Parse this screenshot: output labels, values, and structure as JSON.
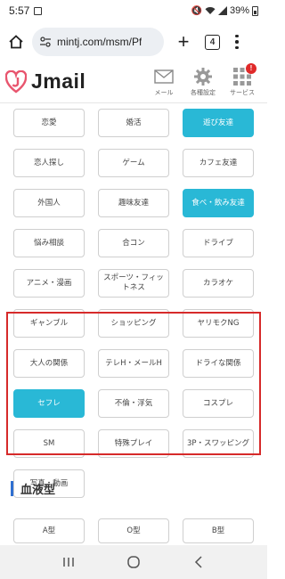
{
  "status": {
    "time": "5:57",
    "battery": "39%"
  },
  "browser": {
    "url": "mintj.com/msm/Pf",
    "tab_count": "4"
  },
  "site": {
    "logo_text": "Jmail",
    "icons": [
      {
        "label": "メール"
      },
      {
        "label": "各種設定"
      },
      {
        "label": "サービス",
        "badge": "!"
      }
    ]
  },
  "tags": [
    {
      "label": "恋愛",
      "selected": false
    },
    {
      "label": "婚活",
      "selected": false
    },
    {
      "label": "遊び友達",
      "selected": true
    },
    {
      "label": "恋人探し",
      "selected": false
    },
    {
      "label": "ゲーム",
      "selected": false
    },
    {
      "label": "カフェ友達",
      "selected": false
    },
    {
      "label": "外国人",
      "selected": false
    },
    {
      "label": "趣味友達",
      "selected": false
    },
    {
      "label": "食べ・飲み友達",
      "selected": true
    },
    {
      "label": "悩み相談",
      "selected": false
    },
    {
      "label": "合コン",
      "selected": false
    },
    {
      "label": "ドライブ",
      "selected": false
    },
    {
      "label": "アニメ・漫画",
      "selected": false
    },
    {
      "label": "スポーツ・フィットネス",
      "selected": false
    },
    {
      "label": "カラオケ",
      "selected": false
    },
    {
      "label": "ギャンブル",
      "selected": false
    },
    {
      "label": "ショッピング",
      "selected": false
    },
    {
      "label": "ヤリモクNG",
      "selected": false
    },
    {
      "label": "大人の関係",
      "selected": false
    },
    {
      "label": "テレH・メールH",
      "selected": false
    },
    {
      "label": "ドライな関係",
      "selected": false
    },
    {
      "label": "セフレ",
      "selected": true
    },
    {
      "label": "不倫・浮気",
      "selected": false
    },
    {
      "label": "コスプレ",
      "selected": false
    },
    {
      "label": "SM",
      "selected": false
    },
    {
      "label": "特殊プレイ",
      "selected": false
    },
    {
      "label": "3P・スワッピング",
      "selected": false
    },
    {
      "label": "写真・動画",
      "selected": false
    }
  ],
  "blood_section": {
    "title": "血液型",
    "options": [
      "A型",
      "O型",
      "B型"
    ]
  },
  "colors": {
    "accent": "#29b8d6",
    "highlight": "#d62a2a",
    "section_bar": "#2f6fd1"
  }
}
